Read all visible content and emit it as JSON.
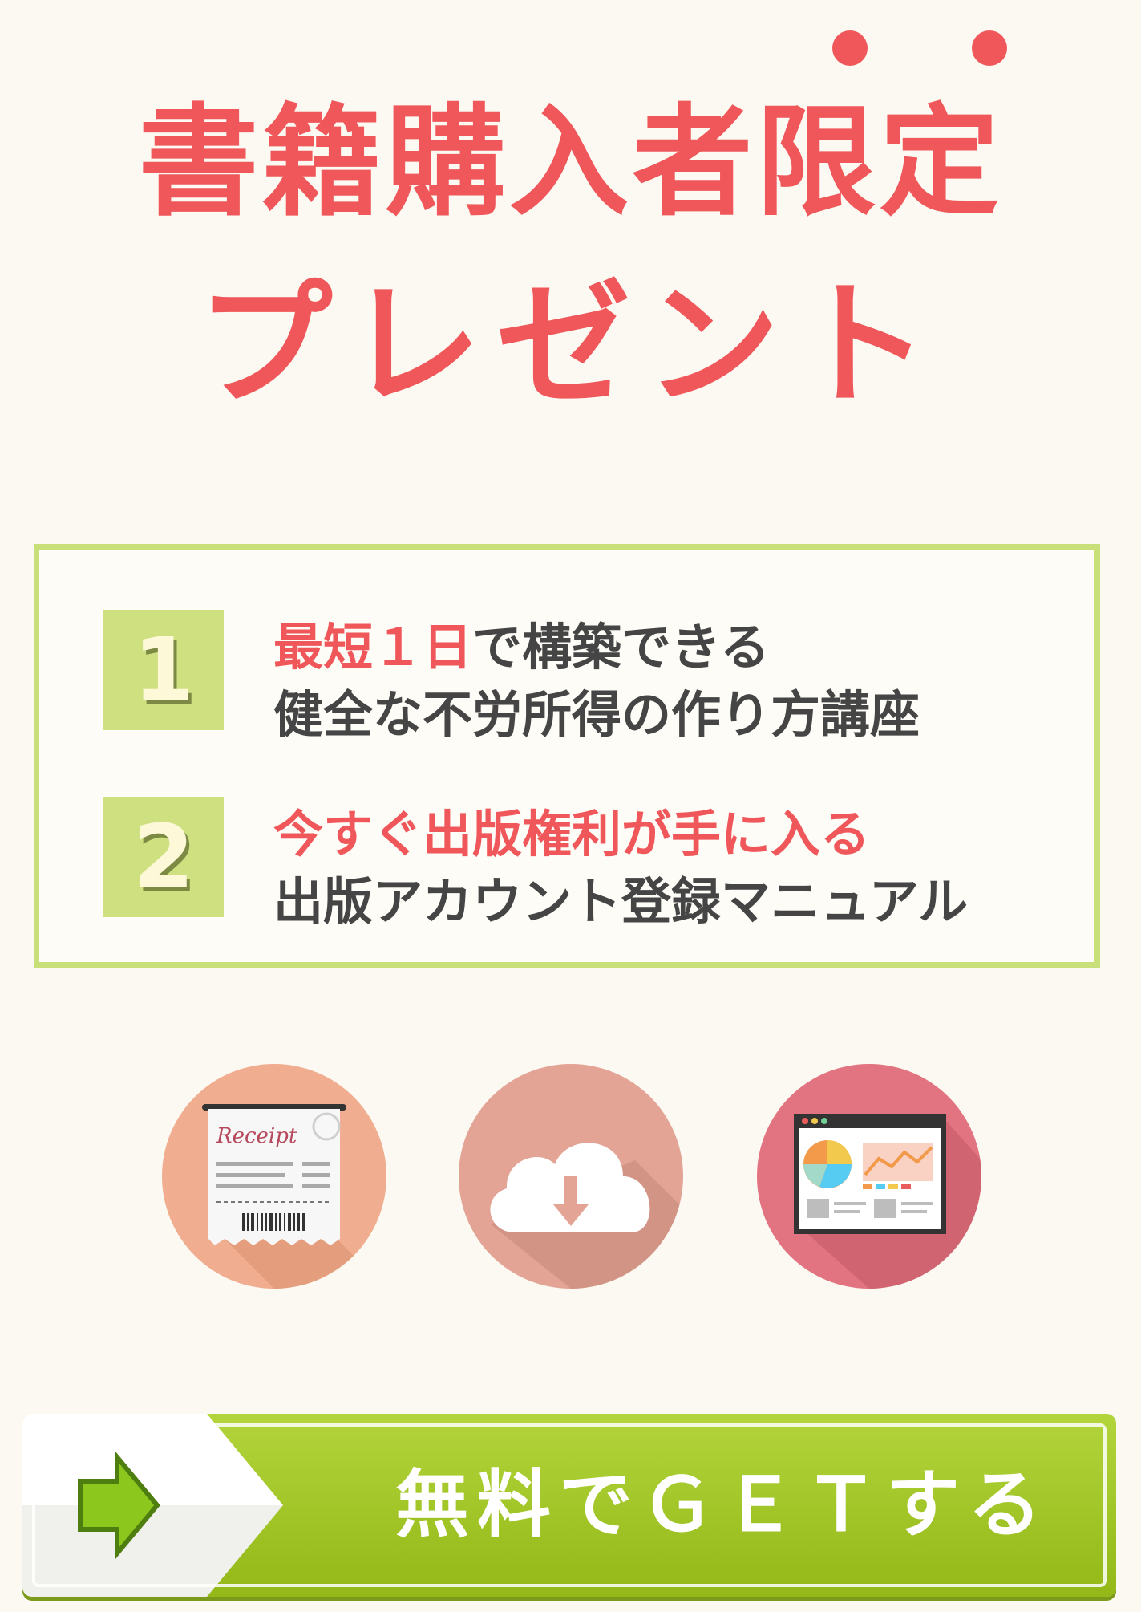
{
  "heading": {
    "line1": "書籍購入者限定",
    "line2": "プレゼント"
  },
  "benefits": [
    {
      "number": "1",
      "line1_accent": "最短１日",
      "line1_rest": "で構築できる",
      "line2": "健全な不労所得の作り方講座"
    },
    {
      "number": "2",
      "line1_accent": "今すぐ出版権利が手に入る",
      "line1_rest": "",
      "line2": "出版アカウント登録マニュアル"
    }
  ],
  "icons": [
    "receipt-icon",
    "cloud-download-icon",
    "dashboard-chart-icon"
  ],
  "receipt_text": "Receipt",
  "cta": {
    "label": "無料でＧＥＴする"
  },
  "colors": {
    "accent": "#f0575b",
    "green": "#c9e07a",
    "button": "#a6cb2a",
    "text": "#454545",
    "background": "#fbf9f1"
  }
}
